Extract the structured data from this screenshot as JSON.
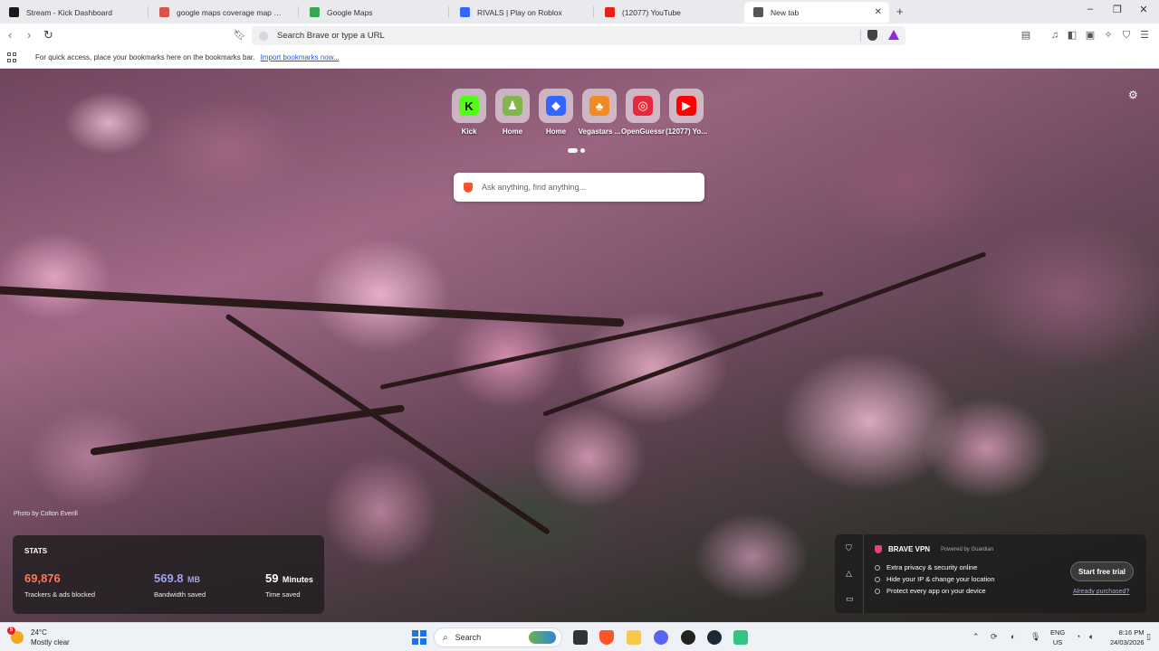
{
  "tabs": [
    {
      "label": "Stream - Kick Dashboard",
      "favicon": "kick-icon",
      "color": "#1a1a1a",
      "active": false
    },
    {
      "label": "google maps coverage map world - ",
      "favicon": "brave-search-icon",
      "color": "#d9534f",
      "active": false
    },
    {
      "label": "Google Maps",
      "favicon": "google-maps-icon",
      "color": "#34a853",
      "active": false
    },
    {
      "label": "RIVALS | Play on Roblox",
      "favicon": "roblox-icon",
      "color": "#3366ff",
      "active": false
    },
    {
      "label": "(12077) YouTube",
      "favicon": "youtube-icon",
      "color": "#e62117",
      "active": false
    },
    {
      "label": "New tab",
      "favicon": "brave-shield-icon",
      "color": "#555555",
      "active": true
    }
  ],
  "toolbar": {
    "address_text": "Search Brave or type a URL"
  },
  "bookmarks_bar": {
    "message": "For quick access, place your bookmarks here on the bookmarks bar.",
    "import_link": "Import bookmarks now..."
  },
  "top_sites": [
    {
      "name": "Kick",
      "icon": "kick-icon",
      "bg": "#53fc18",
      "fg": "#000000",
      "glyph": "K"
    },
    {
      "name": "Home",
      "icon": "chess-pawn-icon",
      "bg": "#81b64c",
      "fg": "#ffffff",
      "glyph": "♟"
    },
    {
      "name": "Home",
      "icon": "roblox-icon",
      "bg": "#3366ff",
      "fg": "#ffffff",
      "glyph": "◆"
    },
    {
      "name": "Vegastars ...",
      "icon": "vegastars-icon",
      "bg": "#f08a24",
      "fg": "#ffffff",
      "glyph": "♣"
    },
    {
      "name": "OpenGuessr",
      "icon": "openguessr-icon",
      "bg": "#e8283c",
      "fg": "#ffffff",
      "glyph": "◎"
    },
    {
      "name": "(12077) Yo...",
      "icon": "youtube-icon",
      "bg": "#ff0000",
      "fg": "#ffffff",
      "glyph": "▶"
    }
  ],
  "ask_box": {
    "placeholder": "Ask anything, find anything..."
  },
  "photo_credit": "Photo by Colton Everill",
  "stats": {
    "title": "STATS",
    "blocked": {
      "value": "69,876",
      "label": "Trackers & ads blocked",
      "color": "#ff7654"
    },
    "bandwidth": {
      "value": "569.8",
      "unit": "MB",
      "label": "Bandwidth saved",
      "color": "#a0a5eb"
    },
    "time": {
      "value": "59",
      "unit": "Minutes",
      "label": "Time saved",
      "color": "#ffffff"
    }
  },
  "vpn": {
    "title": "BRAVE VPN",
    "powered_by": "Powered by Guardian",
    "features": [
      "Extra privacy & security online",
      "Hide your IP & change your location",
      "Protect every app on your device"
    ],
    "cta": "Start free trial",
    "purchased": "Already purchased?"
  },
  "taskbar": {
    "weather_temp": "24°C",
    "weather_desc": "Mostly clear",
    "weather_badge": "5",
    "search_label": "Search",
    "lang_top": "ENG",
    "lang_bottom": "US",
    "time": "8:16 PM",
    "date": "24/03/2026"
  }
}
